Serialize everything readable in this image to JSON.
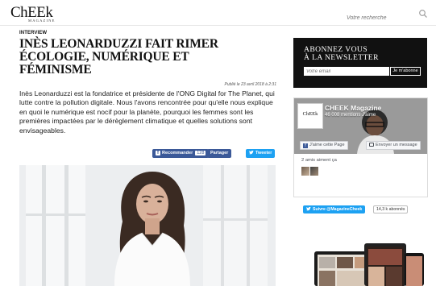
{
  "header": {
    "logo_main": "ChEEk",
    "logo_sub": "MAGAZINE",
    "search_placeholder": "Votre recherche"
  },
  "article": {
    "kicker": "INTERVIEW",
    "title": "INÈS LEONARDUZZI FAIT RIMER ÉCOLOGIE, NUMÉRIQUE ET FÉMINISME",
    "published": "Publié le 23 avril 2018 à 2:31",
    "intro": "Inès Leonarduzzi est la fondatrice et présidente de l'ONG Digital for The Planet, qui lutte contre la pollution digitale. Nous l'avons rencontrée pour qu'elle nous explique en quoi le numérique est nocif pour la planète, pourquoi les femmes sont les premières impactées par le dérèglement climatique et quelles solutions sont envisageables."
  },
  "share": {
    "recommend_label": "Recommander",
    "recommend_count": "128",
    "share_label": "Partager",
    "tweet_label": "Tweeter"
  },
  "newsletter": {
    "line1": "ABONNEZ VOUS",
    "line2": "À LA NEWSLETTER",
    "email_placeholder": "Votre email",
    "button_label": "Je m'abonne"
  },
  "facebook": {
    "avatar_text": "ChEEk",
    "page_name": "CHEEK Magazine",
    "likes": "46 008 mentions J'aime",
    "like_button": "J'aime cette Page",
    "message_button": "Envoyer un message",
    "friends": "2 amis aiment ça"
  },
  "twitter": {
    "follow_label": "Suivre @MagazineCheek",
    "followers": "14,3 k abonnés"
  },
  "colors": {
    "facebook": "#3b5998",
    "twitter": "#1da1f2",
    "newsletter_bg": "#111111"
  }
}
